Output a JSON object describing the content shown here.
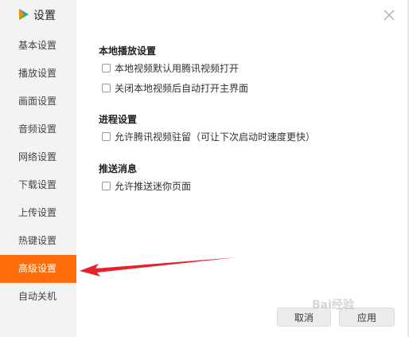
{
  "app": {
    "title": "设置"
  },
  "sidebar": {
    "items": [
      {
        "label": "基本设置"
      },
      {
        "label": "播放设置"
      },
      {
        "label": "画面设置"
      },
      {
        "label": "音频设置"
      },
      {
        "label": "网络设置"
      },
      {
        "label": "下载设置"
      },
      {
        "label": "上传设置"
      },
      {
        "label": "热键设置"
      },
      {
        "label": "高级设置",
        "active": true
      },
      {
        "label": "自动关机"
      }
    ]
  },
  "sections": [
    {
      "title": "本地播放设置",
      "options": [
        {
          "label": "本地视频默认用腾讯视频打开",
          "checked": false
        },
        {
          "label": "关闭本地视频后自动打开主界面",
          "checked": false
        }
      ]
    },
    {
      "title": "进程设置",
      "options": [
        {
          "label": "允许腾讯视频驻留（可让下次启动时速度更快）",
          "checked": false
        }
      ]
    },
    {
      "title": "推送消息",
      "options": [
        {
          "label": "允许推送迷你页面",
          "checked": false
        }
      ]
    }
  ],
  "buttons": {
    "cancel": "取消",
    "apply": "应用"
  },
  "icons": {
    "logo": "tencent-video-logo-icon",
    "close": "close-icon"
  },
  "colors": {
    "active": "#ff6d0a",
    "arrow": "#e8202a",
    "sidebar": "#f3f3f3"
  },
  "watermark": "Bai经验"
}
